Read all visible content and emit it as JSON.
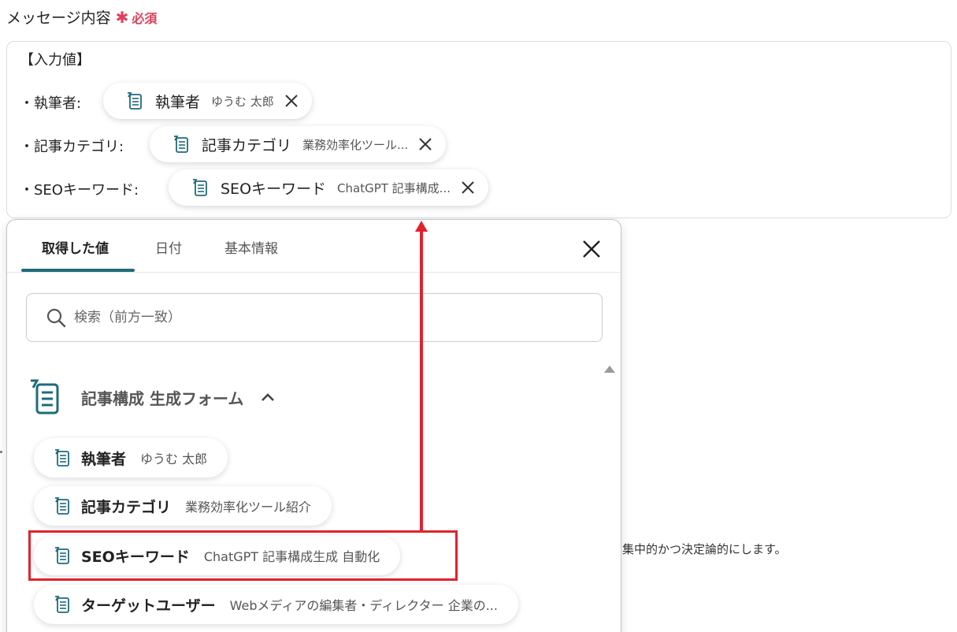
{
  "field": {
    "label": "メッセージ内容",
    "required_mark": "✱",
    "required_text": "必須"
  },
  "message": {
    "heading": "【入力値】",
    "lines": [
      {
        "label": "・執筆者:",
        "chip_name": "執筆者",
        "chip_value": "ゆうむ 太郎"
      },
      {
        "label": "・記事カテゴリ:",
        "chip_name": "記事カテゴリ",
        "chip_value": "業務効率化ツール..."
      },
      {
        "label": "・SEOキーワード:",
        "chip_name": "SEOキーワード",
        "chip_value": "ChatGPT 記事構成..."
      }
    ]
  },
  "background_text": "り集中的かつ決定論的にします。",
  "panel": {
    "tabs": [
      {
        "label": "取得した値",
        "active": true
      },
      {
        "label": "日付",
        "active": false
      },
      {
        "label": "基本情報",
        "active": false
      }
    ],
    "search_placeholder": "検索（前方一致）",
    "group_title": "記事構成 生成フォーム",
    "items": [
      {
        "name": "執筆者",
        "value": "ゆうむ 太郎"
      },
      {
        "name": "記事カテゴリ",
        "value": "業務効率化ツール紹介"
      },
      {
        "name": "SEOキーワード",
        "value": "ChatGPT 記事構成生成 自動化"
      },
      {
        "name": "ターゲットユーザー",
        "value": "Webメディアの編集者・ディレクター 企業の..."
      }
    ]
  },
  "colors": {
    "accent": "#1f6b7c",
    "required": "#e0405a",
    "annotation": "#e1222e"
  }
}
